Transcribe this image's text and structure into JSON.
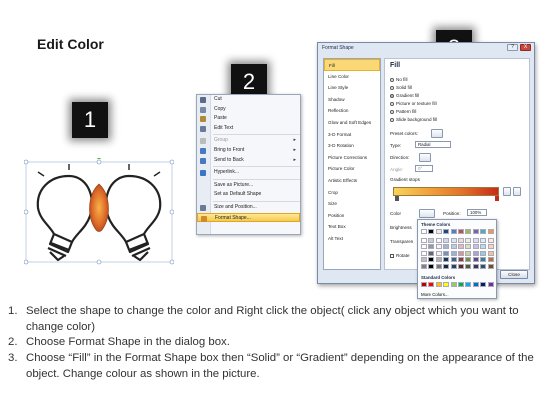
{
  "slide": {
    "title": "Edit Color"
  },
  "steps": {
    "one": "1",
    "two": "2",
    "three": "3"
  },
  "context_menu": {
    "items": [
      {
        "label": "Cut",
        "icon": "scissors-icon",
        "color": "#5a6a8a"
      },
      {
        "label": "Copy",
        "icon": "copy-icon",
        "color": "#7a8aa6"
      },
      {
        "label": "Paste",
        "icon": "paste-icon",
        "color": "#b08a3a"
      },
      {
        "label": "Edit Text",
        "icon": "edit-text-icon",
        "color": "#6a7a9a"
      },
      {
        "label": "Group",
        "icon": "group-icon",
        "color": "#bbbbbb",
        "disabled": true,
        "submenu": true
      },
      {
        "label": "Bring to Front",
        "icon": "bring-front-icon",
        "color": "#4a78c0",
        "submenu": true
      },
      {
        "label": "Send to Back",
        "icon": "send-back-icon",
        "color": "#4a78c0",
        "submenu": true
      },
      {
        "label": "Hyperlink...",
        "icon": "hyperlink-icon",
        "color": "#3c74c8"
      },
      {
        "label": "Save as Picture...",
        "icon": "",
        "color": ""
      },
      {
        "label": "Set as Default Shape",
        "icon": "",
        "color": ""
      },
      {
        "label": "Size and Position...",
        "icon": "size-position-icon",
        "color": "#6a7a9a"
      },
      {
        "label": "Format Shape...",
        "icon": "format-shape-icon",
        "color": "#d08a2a",
        "highlighted": true
      }
    ]
  },
  "dialog": {
    "title": "Format Shape",
    "help": "?",
    "close": "X",
    "nav": [
      "Fill",
      "Line Color",
      "Line Style",
      "Shadow",
      "Reflection",
      "Glow and Soft Edges",
      "3-D Format",
      "3-D Rotation",
      "Picture Corrections",
      "Picture Color",
      "Artistic Effects",
      "Crop",
      "Size",
      "Position",
      "Text Box",
      "Alt Text"
    ],
    "nav_selected": 0,
    "panel_title": "Fill",
    "fill_options": [
      {
        "label": "No fill",
        "checked": false
      },
      {
        "label": "Solid fill",
        "checked": false
      },
      {
        "label": "Gradient fill",
        "checked": true
      },
      {
        "label": "Picture or texture fill",
        "checked": false
      },
      {
        "label": "Pattern fill",
        "checked": false
      },
      {
        "label": "Slide background fill",
        "checked": false
      }
    ],
    "preset_colors_label": "Preset colors:",
    "type_label": "Type:",
    "type_value": "Radial",
    "direction_label": "Direction:",
    "angle_label": "Angle:",
    "angle_value": "0°",
    "gradient_stops_label": "Gradient stops",
    "color_label": "Color",
    "position_label": "Position:",
    "position_value": "100%",
    "brightness_label": "Brightness",
    "transparency_label": "Transparen",
    "rotate_label": "Rotate",
    "close_button": "Close"
  },
  "palette": {
    "theme_label": "Theme Colors",
    "standard_label": "Standard Colors",
    "more_label": "More Colors...",
    "theme_top": [
      "#ffffff",
      "#000000",
      "#eeece1",
      "#1f497d",
      "#4f81bd",
      "#c0504d",
      "#9bbb59",
      "#8064a2",
      "#4bacc6",
      "#f79646"
    ],
    "standard": [
      "#c00000",
      "#ff0000",
      "#ffc000",
      "#ffff00",
      "#92d050",
      "#00b050",
      "#00b0f0",
      "#0070c0",
      "#002060",
      "#7030a0"
    ]
  },
  "instructions": [
    {
      "num": "1.",
      "text": "Select the shape to change the color and Right click the object( click any object which you want to change color)"
    },
    {
      "num": "2.",
      "text": "Choose Format Shape in the dialog box."
    },
    {
      "num": "3.",
      "text": "Choose “Fill” in the Format Shape box then “Solid” or “Gradient” depending on the appearance of the object. Change colour as shown in the picture."
    }
  ],
  "colors": {
    "accent_orange": "#e0702a",
    "highlight_yellow": "#f7c94b",
    "badge_black": "#111111"
  }
}
